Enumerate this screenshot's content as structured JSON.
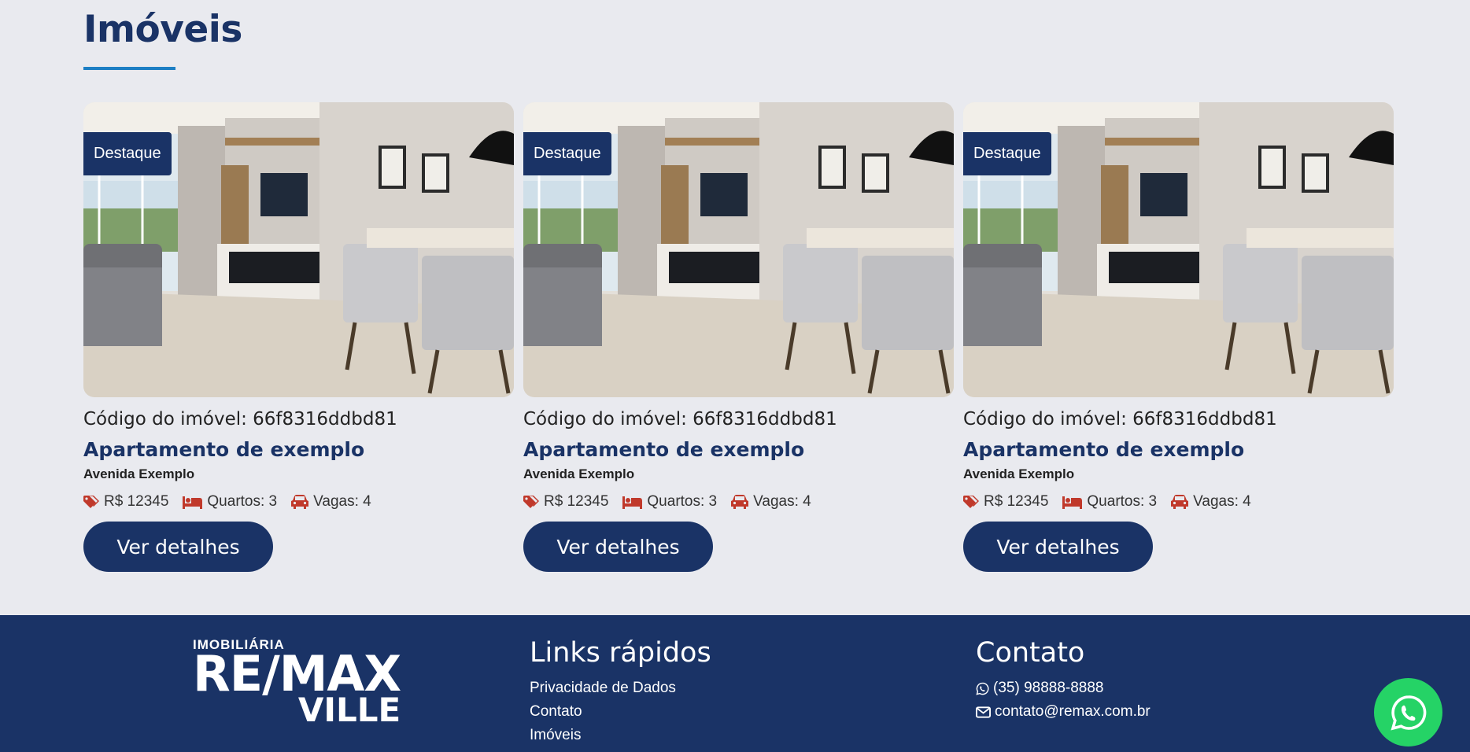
{
  "section": {
    "title": "Imóveis"
  },
  "cards": [
    {
      "badge": "Destaque",
      "code_label": "Código do imóvel: 66f8316ddbd81",
      "title": "Apartamento de exemplo",
      "address": "Avenida Exemplo",
      "price": "R$ 12345",
      "rooms": "Quartos: 3",
      "parking": "Vagas: 4",
      "button": "Ver detalhes"
    },
    {
      "badge": "Destaque",
      "code_label": "Código do imóvel: 66f8316ddbd81",
      "title": "Apartamento de exemplo",
      "address": "Avenida Exemplo",
      "price": "R$ 12345",
      "rooms": "Quartos: 3",
      "parking": "Vagas: 4",
      "button": "Ver detalhes"
    },
    {
      "badge": "Destaque",
      "code_label": "Código do imóvel: 66f8316ddbd81",
      "title": "Apartamento de exemplo",
      "address": "Avenida Exemplo",
      "price": "R$ 12345",
      "rooms": "Quartos: 3",
      "parking": "Vagas: 4",
      "button": "Ver detalhes"
    }
  ],
  "footer": {
    "logo": {
      "top": "IMOBILIÁRIA",
      "main": "RE/MAX",
      "sub": "VILLE"
    },
    "links": {
      "heading": "Links rápidos",
      "items": [
        "Privacidade de Dados",
        "Contato",
        "Imóveis"
      ]
    },
    "contact": {
      "heading": "Contato",
      "phone": "(35) 98888-8888",
      "email": "contato@remax.com.br"
    }
  },
  "icons": {
    "price": "tag-icon",
    "rooms": "bed-icon",
    "parking": "car-icon",
    "phone": "whatsapp-icon",
    "email": "envelope-icon",
    "float": "whatsapp-icon"
  },
  "colors": {
    "brand": "#1a3366",
    "accent": "#1d7fc4",
    "icon_red": "#c0392b",
    "whatsapp": "#25d366",
    "background": "#e9eaef"
  }
}
